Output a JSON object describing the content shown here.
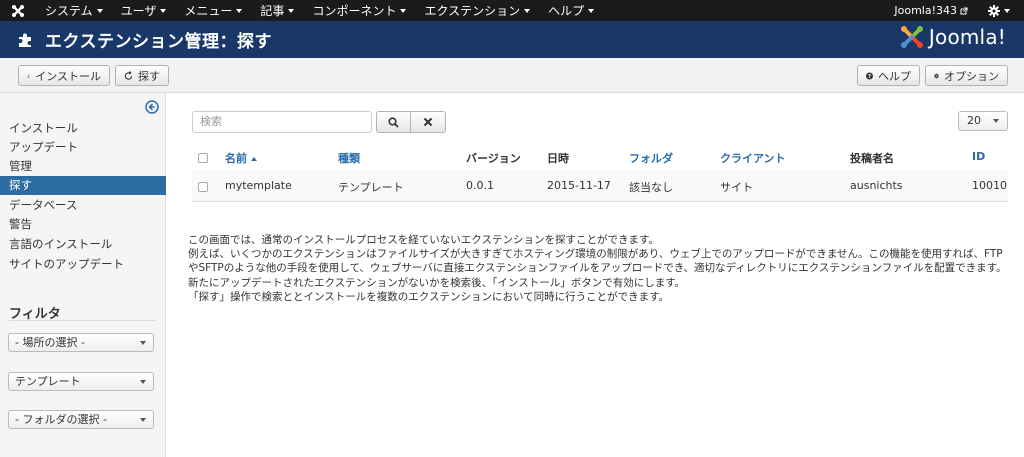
{
  "topnav": {
    "menu": [
      "システム",
      "ユーザ",
      "メニュー",
      "記事",
      "コンポーネント",
      "エクステンション",
      "ヘルプ"
    ],
    "site_link": "Joomla!343"
  },
  "header": {
    "title": "エクステンション管理：探す",
    "logo_text": "Joomla!"
  },
  "toolbar": {
    "install": "インストール",
    "discover": "探す",
    "help": "ヘルプ",
    "options": "オプション"
  },
  "sidebar": {
    "items": [
      "インストール",
      "アップデート",
      "管理",
      "探す",
      "データベース",
      "警告",
      "言語のインストール",
      "サイトのアップデート"
    ],
    "active_index": 3,
    "filter_title": "フィルタ",
    "filters": [
      "- 場所の選択 -",
      "テンプレート",
      "- フォルダの選択 -"
    ]
  },
  "search": {
    "placeholder": "検索"
  },
  "limit": "20",
  "table": {
    "headers": {
      "name": "名前",
      "type": "種類",
      "version": "バージョン",
      "date": "日時",
      "folder": "フォルダ",
      "client": "クライアント",
      "author": "投稿者名",
      "id": "ID"
    },
    "rows": [
      {
        "name": "mytemplate",
        "type": "テンプレート",
        "version": "0.0.1",
        "date": "2015-11-17",
        "folder": "該当なし",
        "client": "サイト",
        "author": "ausnichts",
        "id": "10010"
      }
    ]
  },
  "description": [
    "この画面では、通常のインストールプロセスを経ていないエクステンションを探すことができます。",
    "例えば、いくつかのエクステンションはファイルサイズが大きすぎてホスティング環境の制限があり、ウェブ上でのアップロードができません。この機能を使用すれば、FTPやSFTPのような他の手段を使用して、ウェブサーバに直接エクステンションファイルをアップロードでき、適切なディレクトリにエクステンションファイルを配置できます。",
    "新たにアップデートされたエクステンションがないかを検索後、「インストール」ボタンで有効にします。",
    "「探す」操作で検索ととインストールを複数のエクステンションにおいて同時に行うことができます。"
  ],
  "colors": {
    "header_bg": "#1a3867",
    "topnav_bg": "#1b1b1b",
    "active_item": "#2d6ca2",
    "link": "#2a6ca8"
  }
}
